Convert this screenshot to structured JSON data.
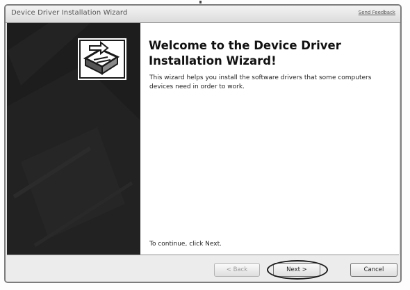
{
  "window": {
    "title": "Device Driver Installation Wizard",
    "feedback_link": "Send Feedback"
  },
  "main": {
    "heading": "Welcome to the Device Driver Installation Wizard!",
    "description": "This wizard helps you install the software drivers that some computers devices need in order to work.",
    "continue_text": "To continue, click Next."
  },
  "buttons": {
    "back": "< Back",
    "next": "Next >",
    "cancel": "Cancel"
  },
  "icons": {
    "wizard": "device-installer-icon"
  }
}
